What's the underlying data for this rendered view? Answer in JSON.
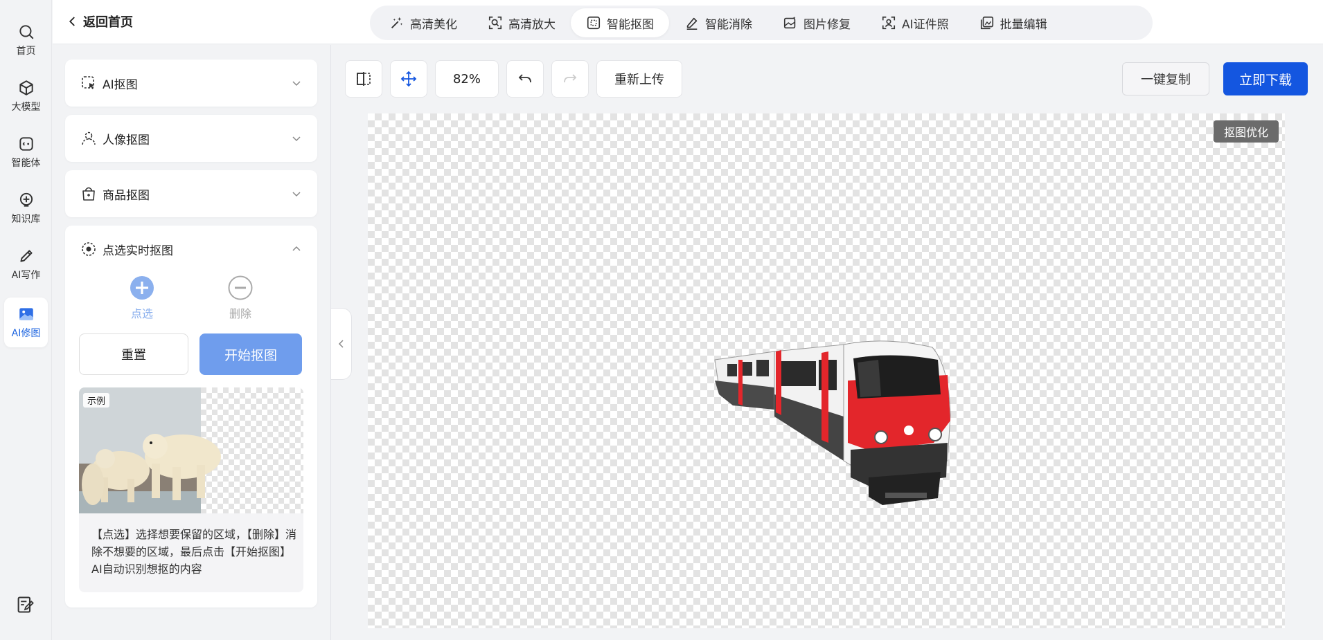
{
  "rail": {
    "items": [
      {
        "label": "首页",
        "icon": "search-icon"
      },
      {
        "label": "大模型",
        "icon": "cube-icon"
      },
      {
        "label": "智能体",
        "icon": "agent-icon"
      },
      {
        "label": "知识库",
        "icon": "knowledge-icon"
      },
      {
        "label": "AI写作",
        "icon": "pen-icon"
      },
      {
        "label": "AI修图",
        "icon": "image-icon"
      }
    ],
    "active": "AI修图"
  },
  "header": {
    "back_label": "返回首页",
    "tabs": [
      {
        "label": "高清美化",
        "icon": "magic-wand-icon"
      },
      {
        "label": "高清放大",
        "icon": "zoom-icon"
      },
      {
        "label": "智能抠图",
        "icon": "cutout-icon"
      },
      {
        "label": "智能消除",
        "icon": "eraser-icon"
      },
      {
        "label": "图片修复",
        "icon": "photo-repair-icon"
      },
      {
        "label": "AI证件照",
        "icon": "id-photo-icon"
      },
      {
        "label": "批量编辑",
        "icon": "batch-edit-icon"
      }
    ],
    "active_tab": "智能抠图"
  },
  "panel": {
    "sections": [
      {
        "label": "AI抠图"
      },
      {
        "label": "人像抠图"
      },
      {
        "label": "商品抠图"
      },
      {
        "label": "点选实时抠图"
      }
    ],
    "modes": {
      "select": "点选",
      "delete": "删除"
    },
    "reset_label": "重置",
    "start_label": "开始抠图",
    "example_tag": "示例",
    "example_text": "【点选】选择想要保留的区域，【删除】消除不想要的区域，最后点击【开始抠图】AI自动识别想抠的内容"
  },
  "toolbar": {
    "zoom": "82%",
    "reupload_label": "重新上传",
    "copy_label": "一键复制",
    "download_label": "立即下载"
  },
  "canvas": {
    "badge": "抠图优化"
  },
  "colors": {
    "accent": "#1456e0",
    "start_button": "#6f9ded",
    "train_red": "#e3262b"
  }
}
